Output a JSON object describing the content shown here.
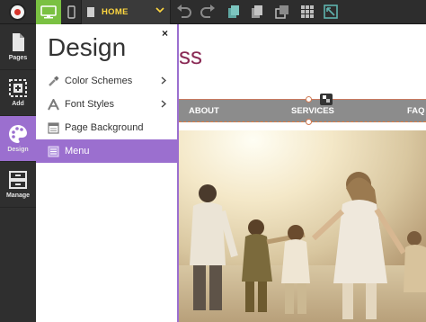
{
  "toolbar": {
    "current_page": "HOME",
    "colors": {
      "active_view": "#7ac142",
      "page_name": "#ffd740"
    }
  },
  "rail": {
    "items": [
      {
        "label": "Pages",
        "icon": "pages-icon"
      },
      {
        "label": "Add",
        "icon": "add-icon"
      },
      {
        "label": "Design",
        "icon": "palette-icon",
        "active": true
      },
      {
        "label": "Manage",
        "icon": "manage-icon"
      }
    ]
  },
  "panel": {
    "title": "Design",
    "close": "×",
    "items": [
      {
        "label": "Color Schemes",
        "icon": "color-dropper-icon",
        "has_submenu": true
      },
      {
        "label": "Font Styles",
        "icon": "font-icon",
        "has_submenu": true
      },
      {
        "label": "Page Background",
        "icon": "background-icon",
        "has_submenu": false
      },
      {
        "label": "Menu",
        "icon": "menu-icon",
        "has_submenu": false,
        "active": true
      }
    ],
    "accent": "#9b6fcf"
  },
  "preview": {
    "title_fragment": "ss",
    "nav": [
      "ABOUT",
      "SERVICES",
      "FAQ"
    ],
    "title_color": "#8a2a55",
    "nav_bg": "#8c8c8c"
  }
}
